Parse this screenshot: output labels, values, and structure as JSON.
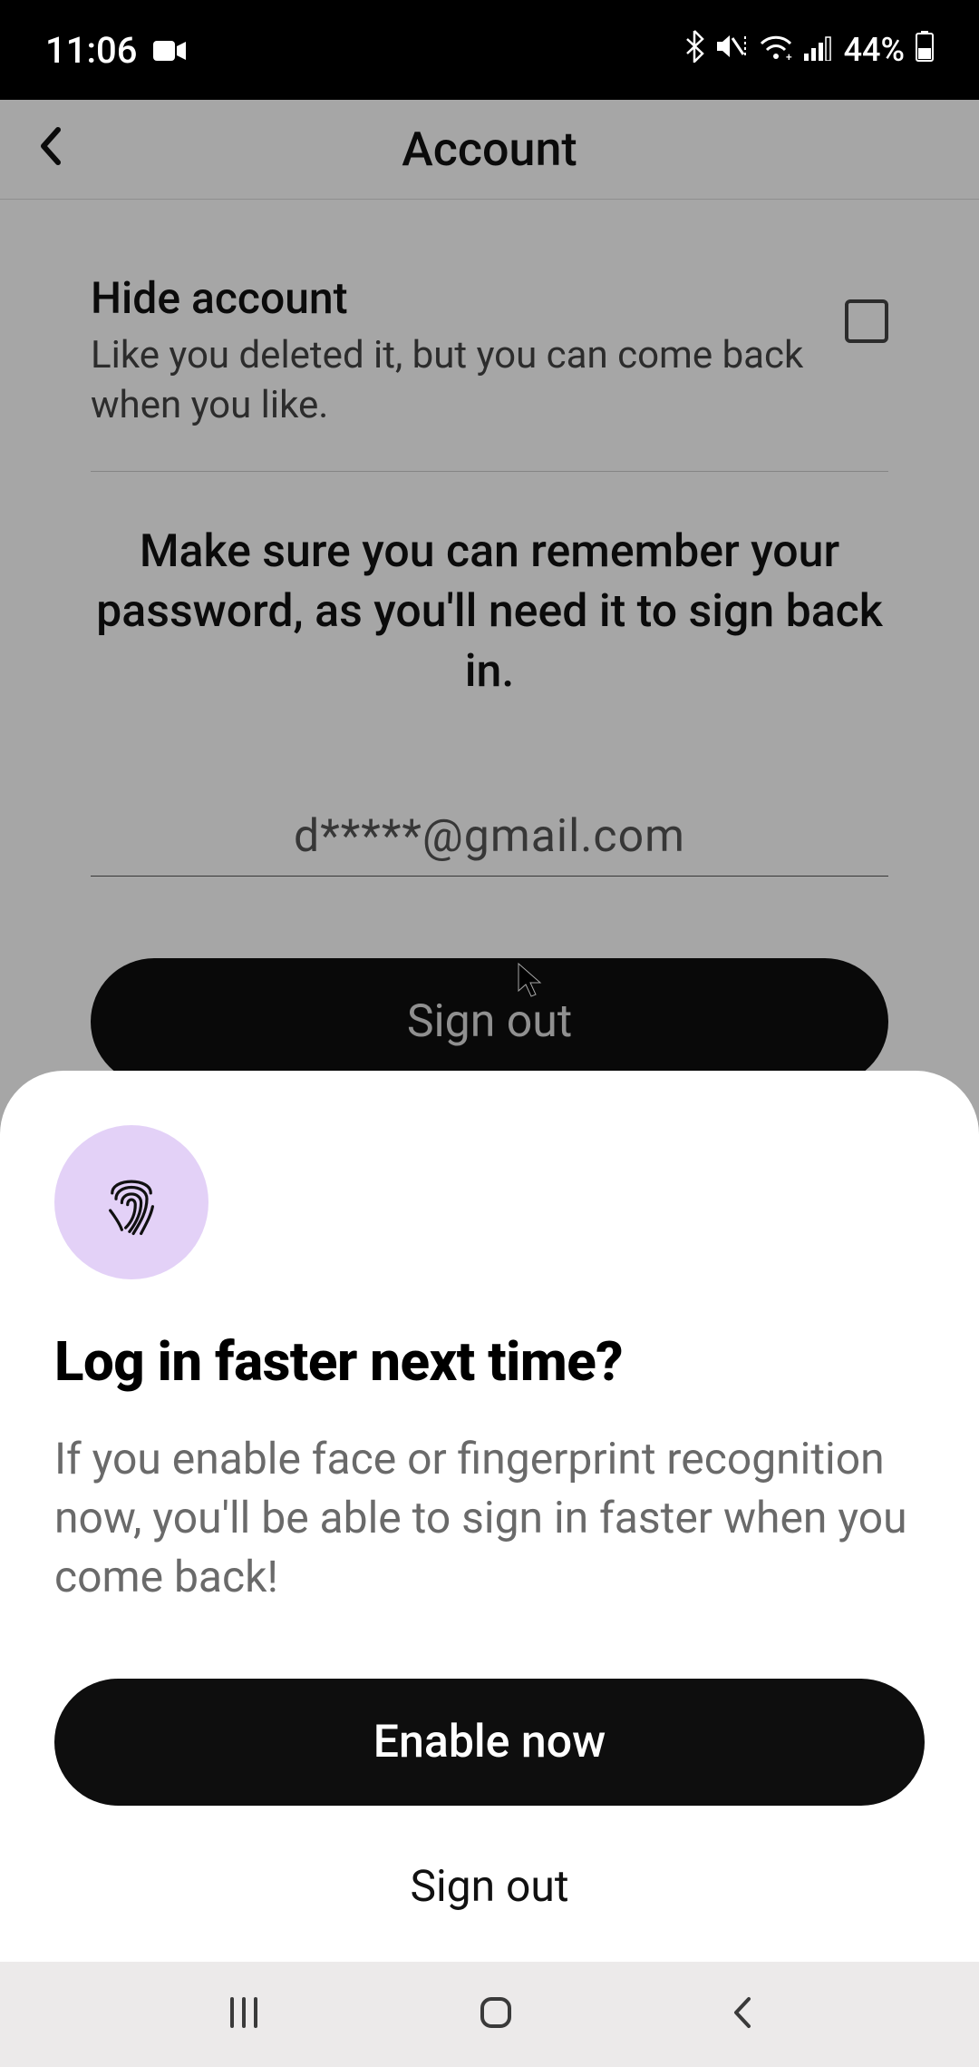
{
  "statusbar": {
    "time": "11:06",
    "battery_text": "44%"
  },
  "header": {
    "title": "Account"
  },
  "hide_account": {
    "title": "Hide account",
    "subtitle": "Like you deleted it, but you can come back when you like."
  },
  "hint": "Make sure you can remember your password, as you'll need it to sign back in.",
  "email": "d*****@gmail.com",
  "buttons": {
    "sign_out": "Sign out"
  },
  "modal": {
    "title": "Log in faster next time?",
    "body": "If you enable face or fingerprint recognition now, you'll be able to sign in faster when you come back!",
    "enable": "Enable now",
    "sign_out": "Sign out"
  }
}
